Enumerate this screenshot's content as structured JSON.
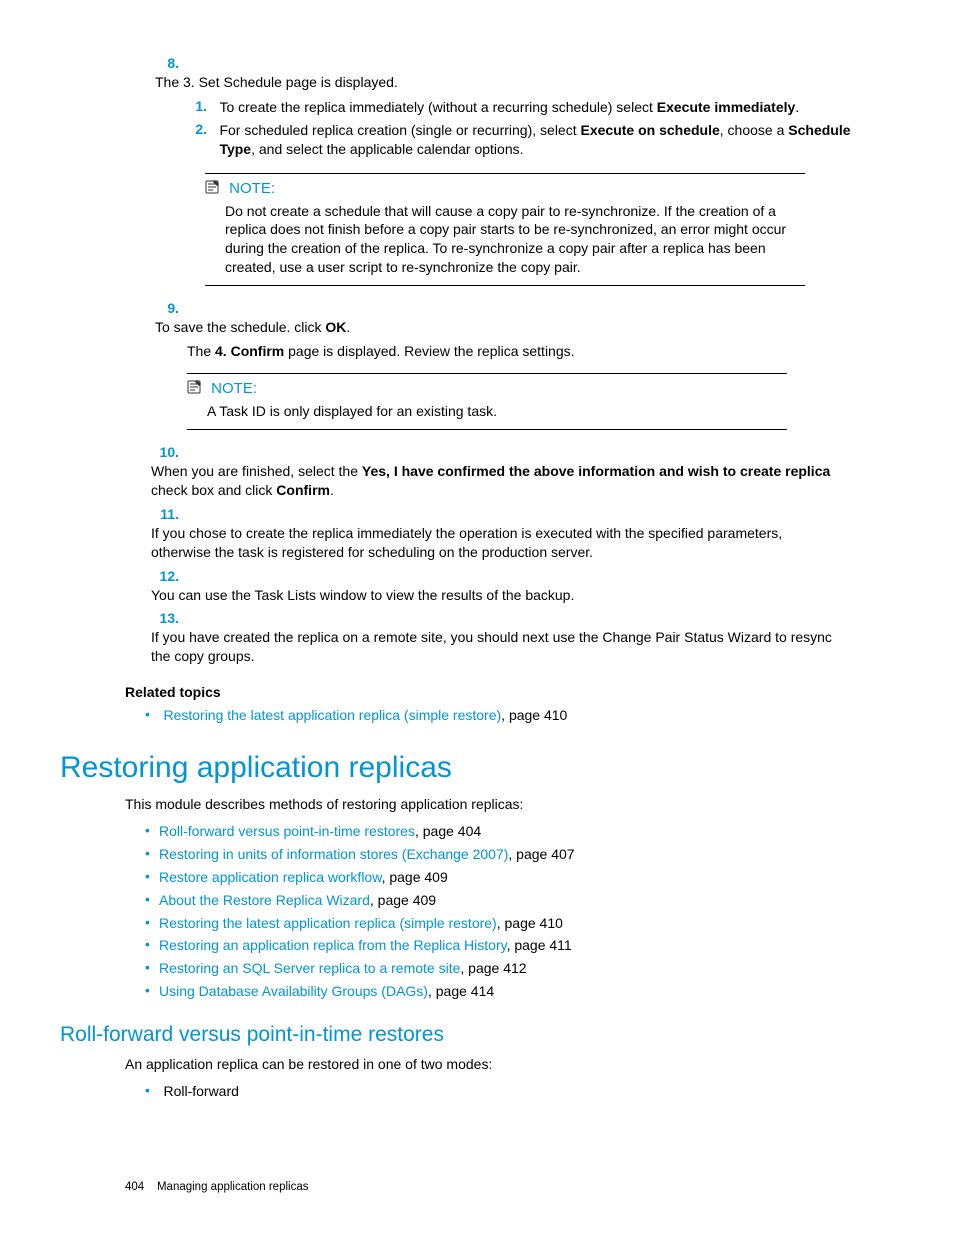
{
  "step8": {
    "num": "8.",
    "text_a": "The 3. Set Schedule page is displayed.",
    "sub1_num": "1.",
    "sub1_a": "To create the replica immediately (without a recurring schedule) select ",
    "sub1_b": "Execute immediately",
    "sub1_c": ".",
    "sub2_num": "2.",
    "sub2_a": "For scheduled replica creation (single or recurring), select ",
    "sub2_b": "Execute on schedule",
    "sub2_c": ", choose a ",
    "sub2_d": "Schedule Type",
    "sub2_e": ", and select the applicable calendar options."
  },
  "note1": {
    "label": "NOTE:",
    "body": "Do not create a schedule that will cause a copy pair to re-synchronize. If the creation of a replica does not finish before a copy pair starts to be re-synchronized, an error might occur during the creation of the replica. To re-synchronize a copy pair after a replica has been created, use a user script to re-synchronize the copy pair."
  },
  "step9": {
    "num": "9.",
    "a": "To save the schedule. click ",
    "b": "OK",
    "c": ".",
    "para_a": "The ",
    "para_b": "4. Confirm",
    "para_c": " page is displayed. Review the replica settings."
  },
  "note2": {
    "label": "NOTE:",
    "body": "A Task ID is only displayed for an existing task."
  },
  "step10": {
    "num": "10.",
    "a": "When you are finished, select the ",
    "b": "Yes, I have confirmed the above information and wish to create replica",
    "c": " check box and click ",
    "d": "Confirm",
    "e": "."
  },
  "step11": {
    "num": "11.",
    "text": "If you chose to create the replica immediately the operation is executed with the specified parameters, otherwise the task is registered for scheduling on the production server."
  },
  "step12": {
    "num": "12.",
    "text": "You can use the Task Lists window to view the results of the backup."
  },
  "step13": {
    "num": "13.",
    "text": "If you have created the replica on a remote site, you should next use the Change Pair Status Wizard to resync the copy groups."
  },
  "related": {
    "head": "Related topics",
    "bullet": "•",
    "item1_link": "Restoring the latest application replica (simple restore)",
    "item1_suffix": ", page 410"
  },
  "h1": "Restoring application replicas",
  "intro": "This module describes methods of restoring application replicas:",
  "toc": {
    "bullet": "•",
    "i1_link": "Roll-forward versus point-in-time restores",
    "i1_suf": ", page 404",
    "i2_link": "Restoring in units of information stores (Exchange 2007)",
    "i2_suf": ", page 407",
    "i3_link": "Restore application replica workflow",
    "i3_suf": ", page 409",
    "i4_link": "About the Restore Replica Wizard",
    "i4_suf": ", page 409",
    "i5_link": "Restoring the latest application replica (simple restore)",
    "i5_suf": ", page 410",
    "i6_link": "Restoring an application replica from the Replica History",
    "i6_suf": ", page 411",
    "i7_link": "Restoring an SQL Server replica to a remote site",
    "i7_suf": ", page 412",
    "i8_link": "Using Database Availability Groups (DAGs)",
    "i8_suf": ", page 414"
  },
  "h2": "Roll-forward versus point-in-time restores",
  "h2_intro": "An application replica can be restored in one of two modes:",
  "mode1": {
    "bullet": "•",
    "text": "Roll-forward"
  },
  "footer": {
    "page": "404",
    "title": "Managing application replicas"
  }
}
